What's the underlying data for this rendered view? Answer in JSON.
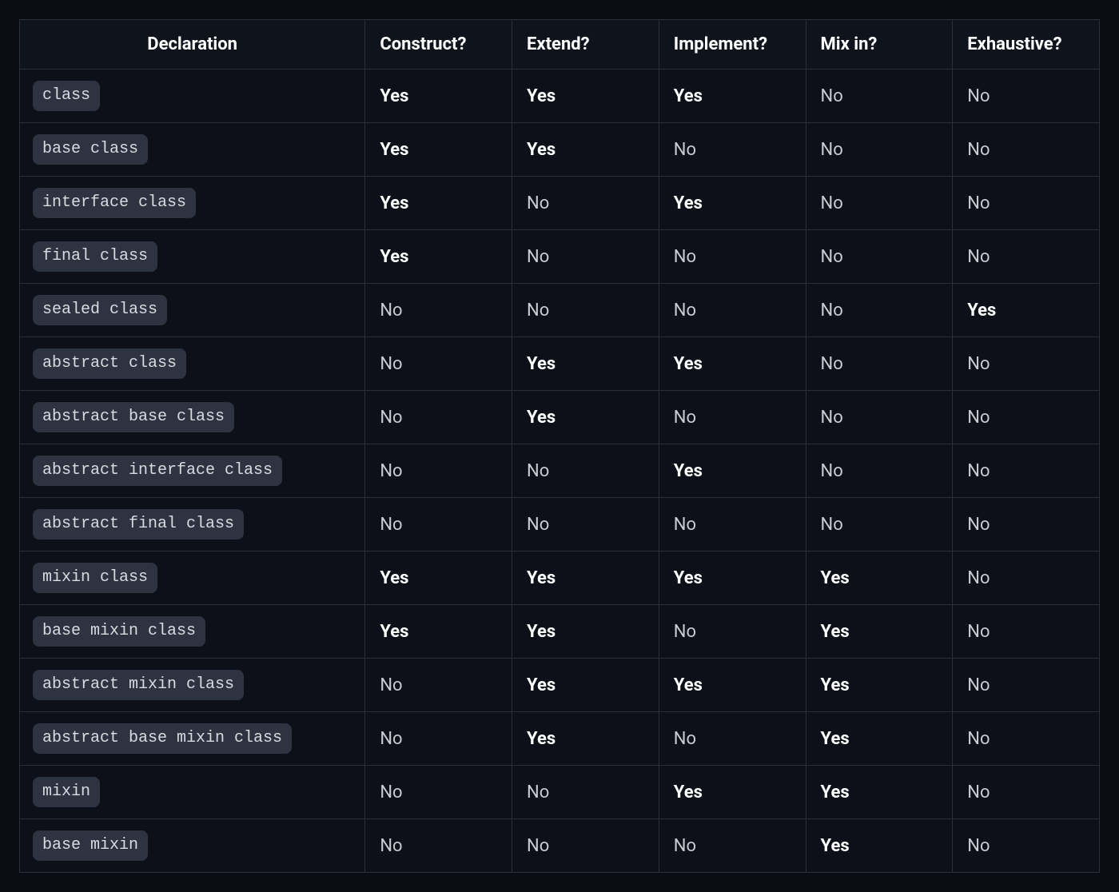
{
  "table": {
    "headers": [
      "Declaration",
      "Construct?",
      "Extend?",
      "Implement?",
      "Mix in?",
      "Exhaustive?"
    ],
    "yes_label": "Yes",
    "no_label": "No",
    "rows": [
      {
        "declaration": "class",
        "capabilities": [
          true,
          true,
          true,
          false,
          false
        ]
      },
      {
        "declaration": "base class",
        "capabilities": [
          true,
          true,
          false,
          false,
          false
        ]
      },
      {
        "declaration": "interface class",
        "capabilities": [
          true,
          false,
          true,
          false,
          false
        ]
      },
      {
        "declaration": "final class",
        "capabilities": [
          true,
          false,
          false,
          false,
          false
        ]
      },
      {
        "declaration": "sealed class",
        "capabilities": [
          false,
          false,
          false,
          false,
          true
        ]
      },
      {
        "declaration": "abstract class",
        "capabilities": [
          false,
          true,
          true,
          false,
          false
        ]
      },
      {
        "declaration": "abstract base class",
        "capabilities": [
          false,
          true,
          false,
          false,
          false
        ]
      },
      {
        "declaration": "abstract interface class",
        "capabilities": [
          false,
          false,
          true,
          false,
          false
        ]
      },
      {
        "declaration": "abstract final class",
        "capabilities": [
          false,
          false,
          false,
          false,
          false
        ]
      },
      {
        "declaration": "mixin class",
        "capabilities": [
          true,
          true,
          true,
          true,
          false
        ]
      },
      {
        "declaration": "base mixin class",
        "capabilities": [
          true,
          true,
          false,
          true,
          false
        ]
      },
      {
        "declaration": "abstract mixin class",
        "capabilities": [
          false,
          true,
          true,
          true,
          false
        ]
      },
      {
        "declaration": "abstract base mixin class",
        "capabilities": [
          false,
          true,
          false,
          true,
          false
        ]
      },
      {
        "declaration": "mixin",
        "capabilities": [
          false,
          false,
          true,
          true,
          false
        ]
      },
      {
        "declaration": "base mixin",
        "capabilities": [
          false,
          false,
          false,
          true,
          false
        ]
      }
    ]
  }
}
